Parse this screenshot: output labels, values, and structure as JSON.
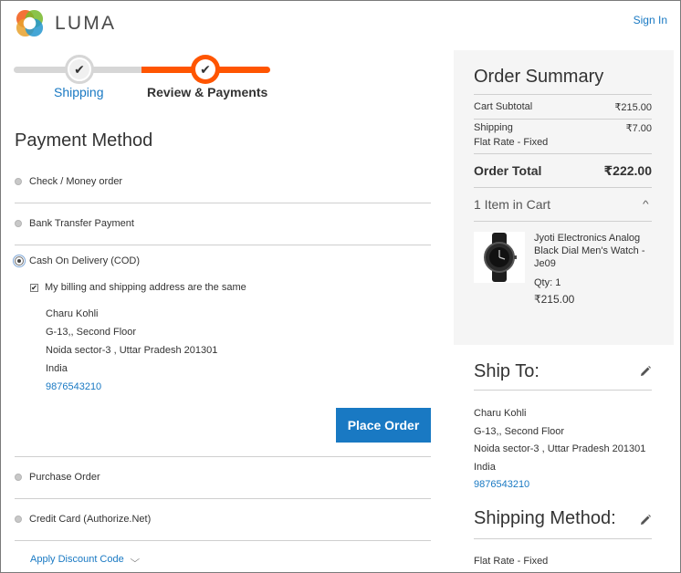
{
  "header": {
    "brand": "LUMA",
    "sign_in": "Sign In"
  },
  "progress": {
    "steps": [
      {
        "label": "Shipping",
        "state": "complete"
      },
      {
        "label": "Review & Payments",
        "state": "active"
      }
    ],
    "active_color": "#ff5501"
  },
  "payment": {
    "title": "Payment Method",
    "methods": [
      {
        "label": "Check / Money order",
        "selected": false
      },
      {
        "label": "Bank Transfer Payment",
        "selected": false
      },
      {
        "label": "Cash On Delivery (COD)",
        "selected": true
      },
      {
        "label": "Purchase Order",
        "selected": false
      },
      {
        "label": "Credit Card (Authorize.Net)",
        "selected": false
      }
    ],
    "same_address_label": "My billing and shipping address are the same",
    "same_address_checked": true,
    "billing_address": {
      "name": "Charu Kohli",
      "street": "G-13,, Second Floor",
      "city_line": "Noida sector-3 , Uttar Pradesh 201301",
      "country": "India",
      "phone": "9876543210"
    },
    "place_order_label": "Place Order",
    "discount_label": "Apply Discount Code"
  },
  "summary": {
    "title": "Order Summary",
    "cart_subtotal_label": "Cart Subtotal",
    "cart_subtotal_value": "₹215.00",
    "shipping_label": "Shipping",
    "shipping_value": "₹7.00",
    "shipping_method": "Flat Rate - Fixed",
    "order_total_label": "Order Total",
    "order_total_value": "₹222.00",
    "items_in_cart": "1 Item in Cart",
    "item": {
      "name": "Jyoti Electronics Analog Black Dial Men's Watch - Je09",
      "qty": "Qty: 1",
      "price": "₹215.00"
    }
  },
  "ship_to": {
    "title": "Ship To:",
    "name": "Charu Kohli",
    "street": "G-13,, Second Floor",
    "city_line": "Noida sector-3 , Uttar Pradesh 201301",
    "country": "India",
    "phone": "9876543210"
  },
  "shipping_method": {
    "title": "Shipping Method:",
    "value": "Flat Rate - Fixed"
  },
  "colors": {
    "link": "#1979c3",
    "primary_button": "#1979c3",
    "progress_active": "#ff5501",
    "summary_bg": "#f5f5f5"
  }
}
